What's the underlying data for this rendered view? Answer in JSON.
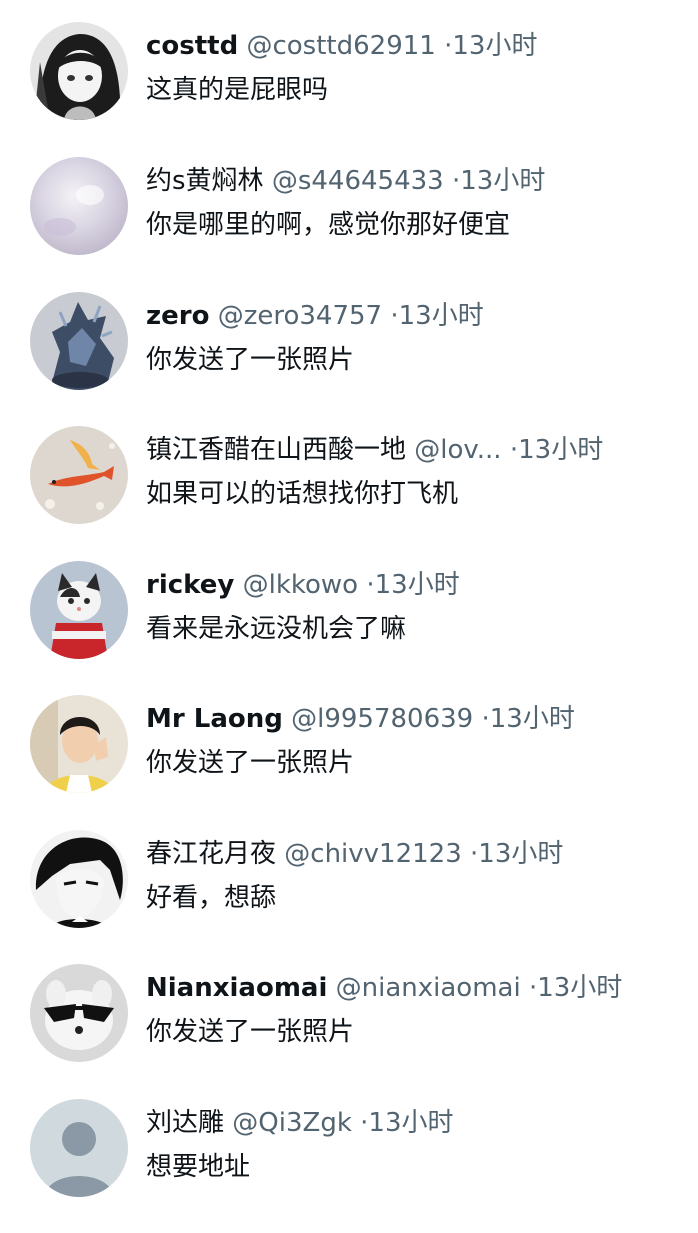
{
  "replies": [
    {
      "name": "costtd",
      "handle": "@costtd62911",
      "dot": "·",
      "time": "13小时",
      "text": "这真的是屁眼吗",
      "avatar_icon": "anime-girl-avatar"
    },
    {
      "name": "约s黄焖林",
      "handle": "@s44645433",
      "dot": "·",
      "time": "13小时",
      "text": "你是哪里的啊，感觉你那好便宜",
      "avatar_icon": "pearl-avatar"
    },
    {
      "name": "zero",
      "handle": "@zero34757",
      "dot": "·",
      "time": "13小时",
      "text": "你发送了一张照片",
      "avatar_icon": "figure-statue-avatar"
    },
    {
      "name": "镇江香醋在山西酸一地",
      "handle": "@lov...",
      "dot": "·",
      "time": "13小时",
      "text": "如果可以的话想找你打飞机",
      "avatar_icon": "koi-fish-avatar"
    },
    {
      "name": "rickey",
      "handle": "@lkkowo",
      "dot": "·",
      "time": "13小时",
      "text": "看来是永远没机会了嘛",
      "avatar_icon": "cat-santa-avatar"
    },
    {
      "name": "Mr Laong",
      "handle": "@l995780639",
      "dot": "·",
      "time": "13小时",
      "text": "你发送了一张照片",
      "avatar_icon": "man-photo-avatar"
    },
    {
      "name": "春江花月夜",
      "handle": "@chivv12123",
      "dot": "·",
      "time": "13小时",
      "text": "好看，想舔",
      "avatar_icon": "anime-man-avatar"
    },
    {
      "name": "Nianxiaomai",
      "handle": "@nianxiaomai",
      "dot": "·",
      "time": "13小时",
      "text": "你发送了一张照片",
      "avatar_icon": "dog-sunglasses-avatar"
    },
    {
      "name": "刘达雕",
      "handle": "@Qi3Zgk",
      "dot": "·",
      "time": "13小时",
      "text": "想要地址",
      "avatar_icon": "default-person-avatar"
    }
  ],
  "colors": {
    "name": "#0f1419",
    "meta": "#536471",
    "background": "#ffffff",
    "default_avatar_bg": "#cfd9de",
    "default_avatar_fg": "#8b98a5"
  }
}
